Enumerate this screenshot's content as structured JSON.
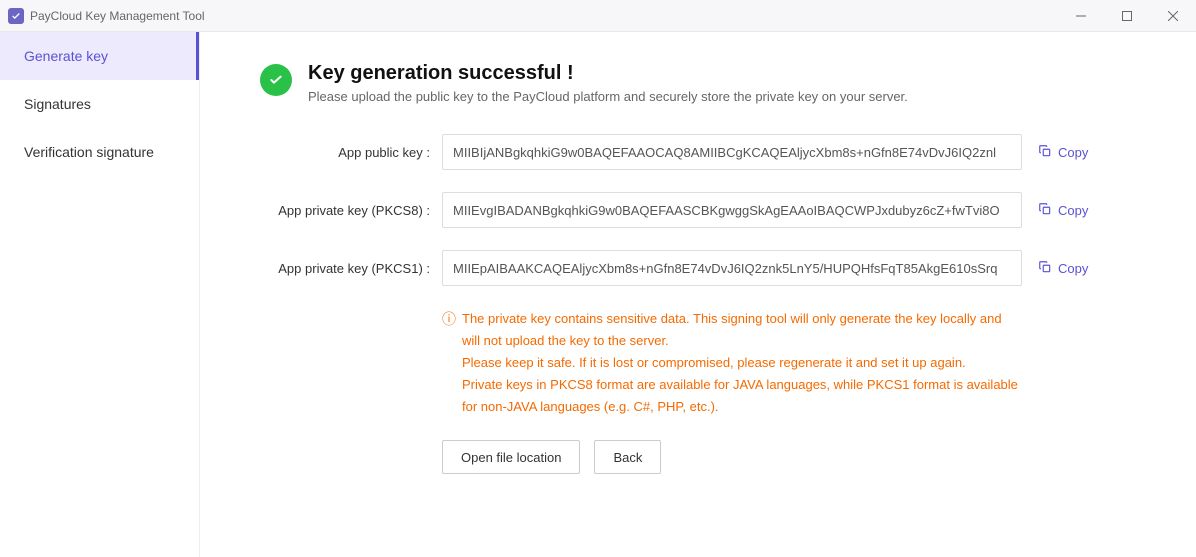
{
  "titlebar": {
    "title": "PayCloud Key Management Tool"
  },
  "sidebar": {
    "items": [
      {
        "label": "Generate key",
        "active": true
      },
      {
        "label": "Signatures",
        "active": false
      },
      {
        "label": "Verification signature",
        "active": false
      }
    ]
  },
  "header": {
    "title": "Key generation successful !",
    "subtitle": "Please upload the public key to the PayCloud platform and securely store the private key on your server."
  },
  "keys": [
    {
      "label": "App public key :",
      "value": "MIIBIjANBgkqhkiG9w0BAQEFAAOCAQ8AMIIBCgKCAQEAljycXbm8s+nGfn8E74vDvJ6IQ2znl",
      "copy": "Copy"
    },
    {
      "label": "App private key (PKCS8) :",
      "value": "MIIEvgIBADANBgkqhkiG9w0BAQEFAASCBKgwggSkAgEAAoIBAQCWPJxdubyz6cZ+fwTvi8O",
      "copy": "Copy"
    },
    {
      "label": "App private key (PKCS1) :",
      "value": "MIIEpAIBAAKCAQEAljycXbm8s+nGfn8E74vDvJ6IQ2znk5LnY5/HUPQHfsFqT85AkgE610sSrq",
      "copy": "Copy"
    }
  ],
  "warning": {
    "text": "The private key contains sensitive data. This signing tool will only generate the key locally and will not upload the key to the server.\nPlease keep it safe. If it is lost or compromised, please regenerate it and set it up again.\nPrivate keys in PKCS8 format are available for JAVA languages, while PKCS1 format is available for non-JAVA languages (e.g. C#, PHP, etc.)."
  },
  "actions": {
    "open_file": "Open file location",
    "back": "Back"
  }
}
